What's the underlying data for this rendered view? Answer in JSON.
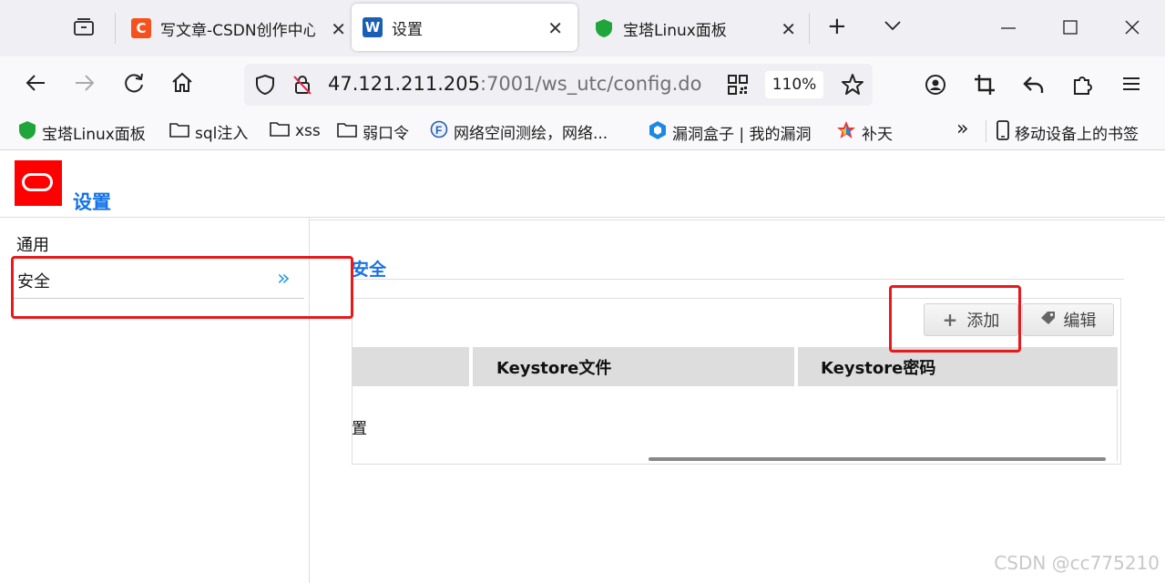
{
  "browser": {
    "tabs": [
      {
        "title": "写文章-CSDN创作中心",
        "favicon": "C"
      },
      {
        "title": "设置",
        "favicon": "W"
      },
      {
        "title": "宝塔Linux面板",
        "favicon": "shield"
      }
    ],
    "new_tab": "+",
    "tab_list": "⌄",
    "url_host": "47.121.211.205",
    "url_rest": ":7001/ws_utc/config.do",
    "zoom": "110%",
    "bookmarks": [
      "宝塔Linux面板",
      "sql注入",
      "xss",
      "弱口令",
      "网络空间测绘，网络...",
      "漏洞盒子 | 我的漏洞",
      "补天"
    ],
    "bookmarks_more": "»",
    "mobile_bookmarks": "移动设备上的书签"
  },
  "page": {
    "title": "设置",
    "sidebar": {
      "items": [
        {
          "label": "通用"
        },
        {
          "label": "安全"
        }
      ],
      "active_arrow": "»"
    },
    "section_title": "安全",
    "toolbar": {
      "add_label": "添加",
      "edit_label": "编辑"
    },
    "table": {
      "columns": [
        "",
        "Keystore文件",
        "Keystore密码"
      ],
      "rows": [
        {
          "cell_0": "置"
        }
      ]
    }
  },
  "watermark": "CSDN @cc775210",
  "colors": {
    "accent": "#1473e6",
    "highlight": "#e8191c",
    "logo": "#ff0000"
  }
}
